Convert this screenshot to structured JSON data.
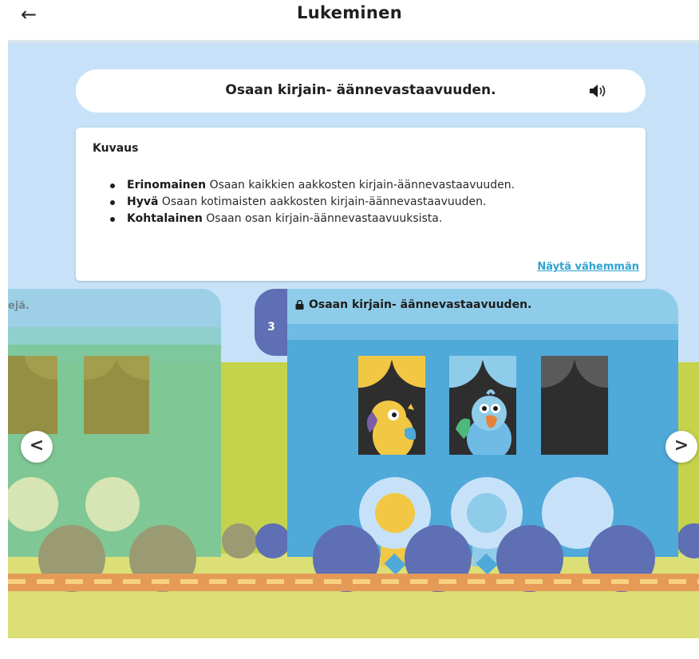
{
  "header": {
    "title": "Lukeminen",
    "back_icon": "←"
  },
  "objective": {
    "text": "Osaan kirjain- äännevastaavuuden.",
    "sound_icon": "speaker-icon"
  },
  "description": {
    "title": "Kuvaus",
    "items": [
      {
        "level": "Erinomainen",
        "text": " Osaan kaikkien aakkosten kirjain-äännevastaavuuden."
      },
      {
        "level": "Hyvä",
        "text": " Osaan kotimaisten aakkosten kirjain-äännevastaavuuden."
      },
      {
        "level": "Kohtalainen",
        "text": " Osaan osan kirjain-äännevastaavuuksista."
      }
    ],
    "toggle_label": "Näytä vähemmän"
  },
  "carousel": {
    "prev_icon": "<",
    "next_icon": ">",
    "prev_card_partial_text": "ejä.",
    "current_card": {
      "number": "3",
      "title": "Osaan kirjain- äännevastaavuuden.",
      "locked_icon": "lock-icon",
      "windows": [
        "gold-parrot",
        "light-parrot",
        "empty"
      ],
      "medals": [
        "gold",
        "light-blue",
        "empty"
      ]
    }
  },
  "colors": {
    "sky": "#c7e2f8",
    "grass": "#c4d34b",
    "train_blue": "#4fa9d9",
    "train_dark": "#5e6fb3",
    "gold": "#f2c744",
    "link": "#2ea3d1"
  }
}
